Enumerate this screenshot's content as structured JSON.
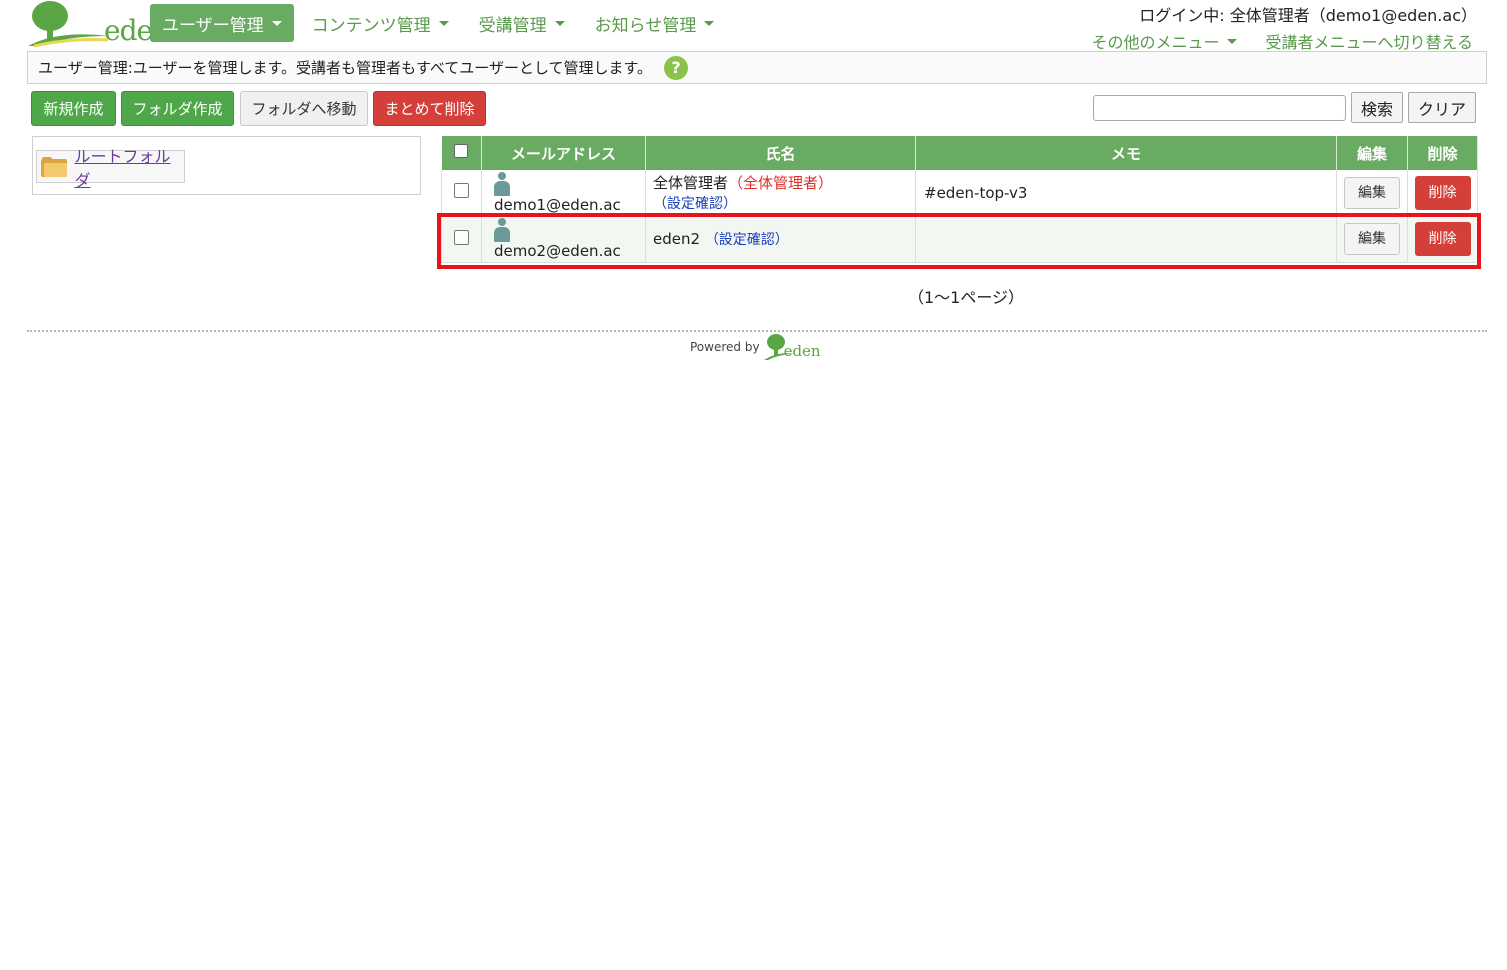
{
  "header": {
    "logo_text": "eden",
    "nav": [
      {
        "label": "ユーザー管理",
        "active": true
      },
      {
        "label": "コンテンツ管理",
        "active": false
      },
      {
        "label": "受講管理",
        "active": false
      },
      {
        "label": "お知らせ管理",
        "active": false
      }
    ],
    "login_info": "ログイン中: 全体管理者（demo1@eden.ac）",
    "other_menu": "その他のメニュー",
    "switch_menu": "受講者メニューへ切り替える"
  },
  "description": {
    "text": "ユーザー管理:ユーザーを管理します。受講者も管理者もすべてユーザーとして管理します。",
    "help_icon": "?"
  },
  "toolbar": {
    "new_label": "新規作成",
    "new_folder_label": "フォルダ作成",
    "move_label": "フォルダへ移動",
    "bulk_delete_label": "まとめて削除",
    "search_value": "",
    "search_label": "検索",
    "clear_label": "クリア"
  },
  "folders": {
    "root_label": "ルートフォルダ"
  },
  "table": {
    "headers": {
      "email": "メールアドレス",
      "name": "氏名",
      "memo": "メモ",
      "edit": "編集",
      "delete": "削除"
    },
    "rows": [
      {
        "email": "demo1@eden.ac",
        "name": "全体管理者",
        "role": "（全体管理者）",
        "settings": "（設定確認）",
        "memo": "#eden-top-v3",
        "edit": "編集",
        "delete": "削除"
      },
      {
        "email": "demo2@eden.ac",
        "name": "eden2",
        "role": "",
        "settings": "（設定確認）",
        "memo": "",
        "edit": "編集",
        "delete": "削除"
      }
    ]
  },
  "pager": "（1～1ページ）",
  "footer": {
    "powered_by": "Powered by",
    "logo_text": "eden"
  },
  "colors": {
    "brand_green": "#6aab63",
    "danger_red": "#d43f3a",
    "highlight_red": "#e8141d"
  }
}
